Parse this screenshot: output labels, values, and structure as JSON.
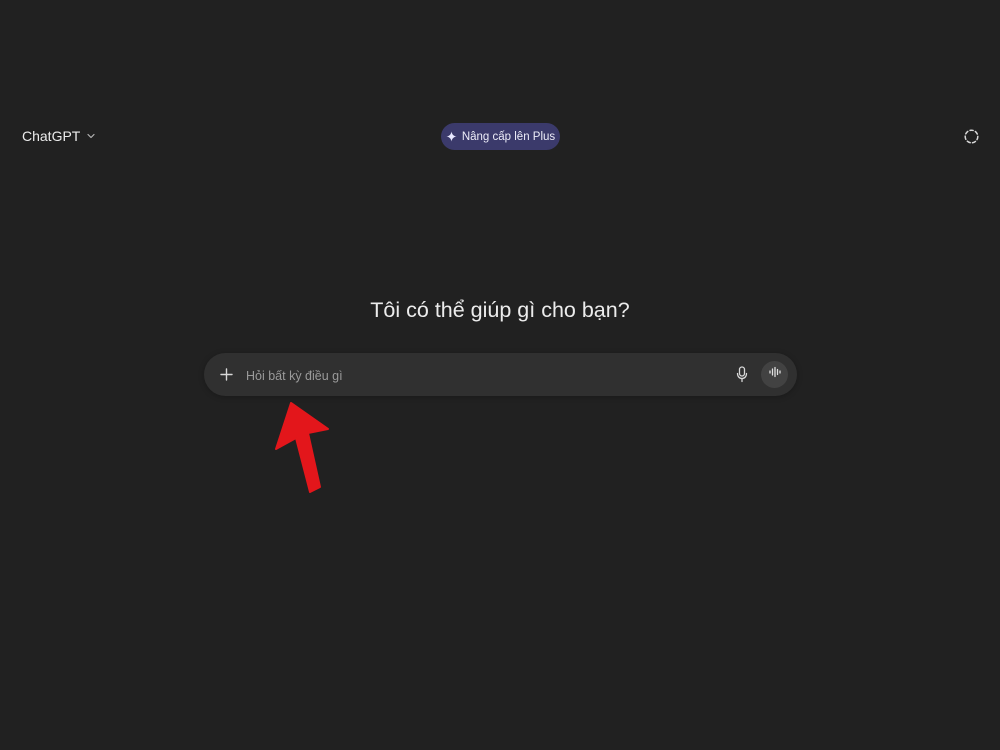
{
  "header": {
    "model_name": "ChatGPT",
    "upgrade_label": "Nâng cấp lên Plus",
    "icons": {
      "model_chevron": "chevron-down-icon",
      "upgrade": "sparkle-icon",
      "temporary_chat": "dashed-circle-icon"
    }
  },
  "main": {
    "headline": "Tôi có thể giúp gì cho bạn?"
  },
  "composer": {
    "placeholder": "Hỏi bất kỳ điều gì",
    "value": "",
    "icons": {
      "attach": "plus-icon",
      "dictate": "microphone-icon",
      "voice_mode": "voice-waveform-icon"
    }
  },
  "annotation": {
    "arrow_color": "#e3161b",
    "points_to": "composer-input"
  },
  "colors": {
    "background": "#212121",
    "composer": "#303030",
    "upgrade_pill": "#3b3a6b",
    "text": "#ececec"
  }
}
